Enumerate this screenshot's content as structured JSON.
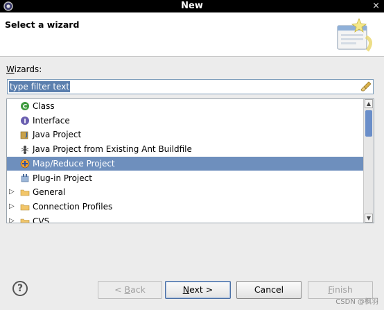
{
  "window": {
    "title": "New",
    "close_glyph": "×"
  },
  "header": {
    "heading": "Select a wizard",
    "image": "wizard-banner-icon"
  },
  "wizards_label": {
    "accel": "W",
    "rest": "izards:"
  },
  "filter": {
    "value": "type filter text",
    "clear_icon": "eraser-icon"
  },
  "tree": {
    "items": [
      {
        "label": "Class",
        "icon": "class-icon",
        "indent": 1,
        "selected": false
      },
      {
        "label": "Interface",
        "icon": "interface-icon",
        "indent": 1,
        "selected": false
      },
      {
        "label": "Java Project",
        "icon": "java-project-icon",
        "indent": 1,
        "selected": false
      },
      {
        "label": "Java Project from Existing Ant Buildfile",
        "icon": "ant-icon",
        "indent": 1,
        "selected": false
      },
      {
        "label": "Map/Reduce Project",
        "icon": "mapreduce-icon",
        "indent": 1,
        "selected": true
      },
      {
        "label": "Plug-in Project",
        "icon": "plugin-icon",
        "indent": 1,
        "selected": false
      },
      {
        "label": "General",
        "icon": "folder-icon",
        "indent": 0,
        "expandable": true,
        "selected": false
      },
      {
        "label": "Connection Profiles",
        "icon": "folder-icon",
        "indent": 0,
        "expandable": true,
        "selected": false
      },
      {
        "label": "CVS",
        "icon": "folder-icon",
        "indent": 0,
        "expandable": true,
        "selected": false
      }
    ]
  },
  "buttons": {
    "back": {
      "accel": "B",
      "pre": "< ",
      "rest": "ack"
    },
    "next": {
      "accel": "N",
      "rest": "ext >"
    },
    "cancel": "Cancel",
    "finish": {
      "accel": "F",
      "rest": "inish"
    }
  },
  "help_glyph": "?",
  "watermark": "CSDN @枫羽"
}
